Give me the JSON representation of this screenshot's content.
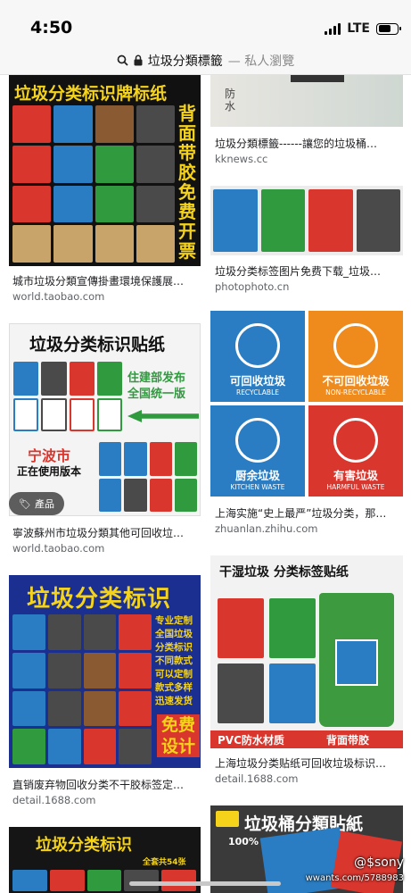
{
  "status_bar": {
    "time": "4:50",
    "network": "LTE",
    "battery_level": 0.65
  },
  "url_bar": {
    "query": "垃圾分類標籤",
    "suffix": "— 私人瀏覽",
    "icons": [
      "search-icon",
      "lock-icon"
    ]
  },
  "results": [
    {
      "image_title": "垃圾分类标识牌标纸",
      "image_side_text": "背面带胶免费开票",
      "caption": "城市垃圾分類宣傳掛畫環境保護展…",
      "domain": "world.taobao.com"
    },
    {
      "image_text": "防水",
      "caption": "垃圾分類標籤------讓您的垃圾桶…",
      "domain": "kknews.cc"
    },
    {
      "caption": "垃圾分类标签图片免费下载_垃圾…",
      "domain": "photophoto.cn"
    },
    {
      "image_title": "垃圾分类标识贴纸",
      "image_promo": "住建部发布 全国统一版",
      "image_city": "宁波市",
      "image_city_sub": "正在使用版本",
      "badge": "產品",
      "caption": "寧波蘇州市垃圾分類其他可回收垃…",
      "domain": "world.taobao.com"
    },
    {
      "panels": [
        {
          "label": "可回收垃圾",
          "sub": "RECYCLABLE",
          "color": "#2a7dc2"
        },
        {
          "label": "不可回收垃圾",
          "sub": "NON-RECYCLABLE",
          "color": "#ef8a1c"
        },
        {
          "label": "厨余垃圾",
          "sub": "KITCHEN WASTE",
          "color": "#2a7dc2"
        },
        {
          "label": "有害垃圾",
          "sub": "HARMFUL WASTE",
          "color": "#d9362e"
        }
      ],
      "caption": "上海实施“史上最严”垃圾分类，那…",
      "domain": "zhuanlan.zhihu.com"
    },
    {
      "image_title": "垃圾分类标识",
      "image_side_text": [
        "专业定制",
        "全国垃圾",
        "分类标识",
        "不同款式",
        "可以定制",
        "款式多样",
        "迅速发货"
      ],
      "image_free": "免费设计",
      "caption": "直销废弃物回收分类不干胶标签定…",
      "domain": "detail.1688.com"
    },
    {
      "image_title": "干湿垃圾 分类标签贴纸",
      "image_footer_left": "PVC防水材质",
      "image_footer_right": "背面带胶",
      "caption": "上海垃圾分类贴纸可回收垃圾标识…",
      "domain": "detail.1688.com"
    },
    {
      "image_title": "垃圾分类标识",
      "image_sub": "全套共54张"
    },
    {
      "image_title": "垃圾桶分類貼紙",
      "image_badge": "100%"
    }
  ],
  "watermark": {
    "line1": "@$sony",
    "line2": "wwants.com/5788983"
  },
  "colors": {
    "blue": "#2a7dc2",
    "green": "#2f9a3e",
    "red": "#d9362e",
    "gray": "#4a4a4a",
    "yellow": "#f5d31a"
  }
}
